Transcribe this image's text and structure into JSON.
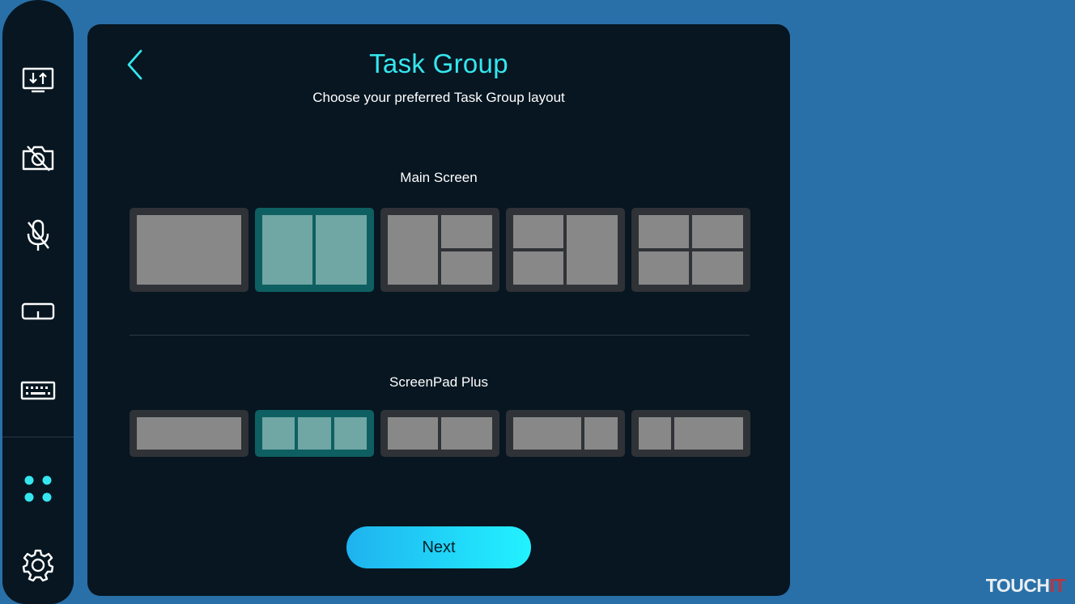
{
  "sidebar": {
    "items": [
      {
        "icon": "screen-transfer-icon"
      },
      {
        "icon": "camera-off-icon"
      },
      {
        "icon": "microphone-off-icon"
      },
      {
        "icon": "touchpad-icon"
      },
      {
        "icon": "keyboard-icon"
      },
      {
        "icon": "task-group-icon",
        "active": true
      },
      {
        "icon": "gear-icon"
      }
    ],
    "accent_color": "#35e6ef"
  },
  "header": {
    "title": "Task Group",
    "subtitle": "Choose your preferred Task Group layout"
  },
  "main_screen": {
    "label": "Main Screen",
    "layouts": [
      {
        "id": "full",
        "selected": false
      },
      {
        "id": "two-columns",
        "selected": true
      },
      {
        "id": "left-half-right-stacked",
        "selected": false
      },
      {
        "id": "left-stacked-right-half",
        "selected": false
      },
      {
        "id": "quad",
        "selected": false
      }
    ]
  },
  "screenpad_plus": {
    "label": "ScreenPad Plus",
    "layouts": [
      {
        "id": "full",
        "selected": false
      },
      {
        "id": "three-columns",
        "selected": true
      },
      {
        "id": "two-columns",
        "selected": false
      },
      {
        "id": "wide-left-narrow-right",
        "selected": false
      },
      {
        "id": "narrow-left-wide-right",
        "selected": false
      }
    ]
  },
  "next_button": {
    "label": "Next"
  },
  "watermark": {
    "part1": "TOUCH",
    "part2": "IT"
  },
  "colors": {
    "background": "#2970a8",
    "panel": "#071621",
    "selected_tile": "#0e5f61",
    "tile": "#2f3236",
    "button_gradient_start": "#1fb2ef",
    "button_gradient_end": "#22f2ff"
  }
}
